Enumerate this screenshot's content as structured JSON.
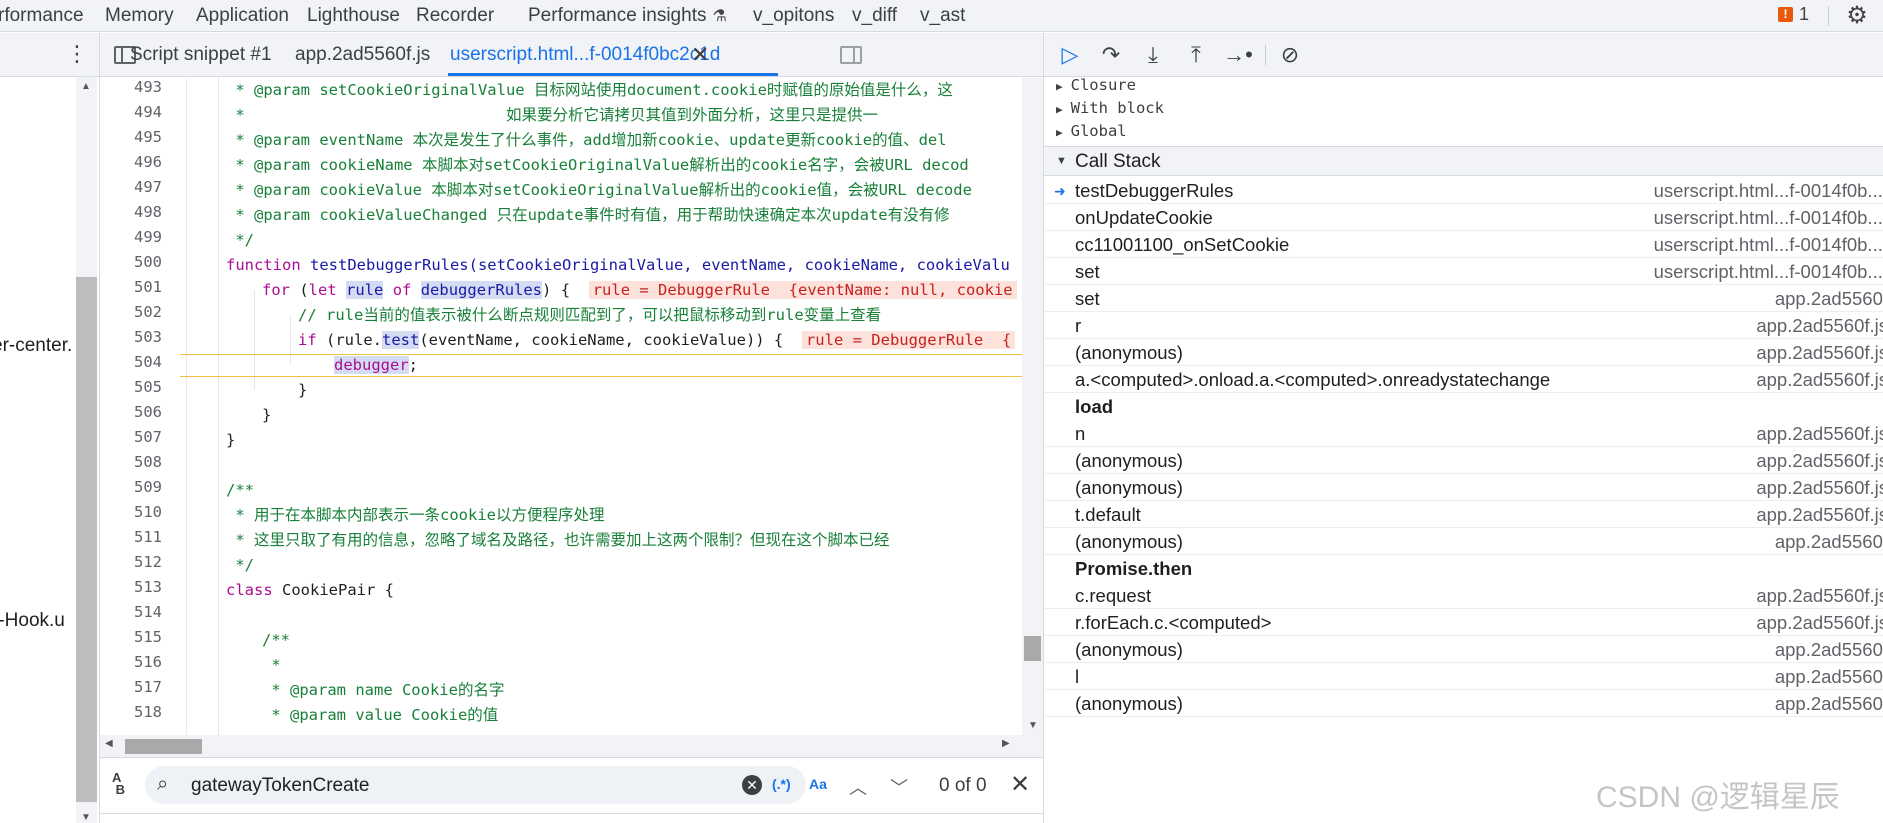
{
  "top_tabs": [
    "rformance",
    "Memory",
    "Application",
    "Lighthouse",
    "Recorder",
    "Performance insights",
    "v_opitons",
    "v_diff",
    "v_ast"
  ],
  "issues_count": "1",
  "navigator": {
    "items": [
      "er-center.",
      "r-Hook.u"
    ]
  },
  "editor_tabs": {
    "tabs": [
      "Script snippet #1",
      "app.2ad5560f.js",
      "userscript.html...f-0014f0bc2c1d"
    ],
    "active_index": 2
  },
  "code": {
    "line_numbers": [
      "493",
      "494",
      "495",
      "496",
      "497",
      "498",
      "499",
      "500",
      "501",
      "502",
      "503",
      "504",
      "505",
      "506",
      "507",
      "508",
      "509",
      "510",
      "511",
      "512",
      "513",
      "514",
      "515",
      "516",
      "517",
      "518"
    ],
    "l493": " * @param setCookieOriginalValue 目标网站使用document.cookie时赋值的原始值是什么，这",
    "l494": " *                            如果要分析它请拷贝其值到外面分析，这里只是提供一",
    "l495": " * @param eventName 本次是发生了什么事件，add增加新cookie、update更新cookie的值、del",
    "l496": " * @param cookieName 本脚本对setCookieOriginalValue解析出的cookie名字，会被URL decod",
    "l497": " * @param cookieValue 本脚本对setCookieOriginalValue解析出的cookie值，会被URL decode",
    "l498": " * @param cookieValueChanged 只在update事件时有值，用于帮助快速确定本次update有没有修",
    "l499": " */",
    "l500_kw": "function ",
    "l500_fn": "testDebuggerRules",
    "l500_args": "(setCookieOriginalValue, eventName, cookieName, cookieValu",
    "l501_for": "for",
    "l501_a": " (",
    "l501_let": "let",
    "l501_rule": "rule",
    "l501_of": "of",
    "l501_dr": "debuggerRules",
    "l501_b": ") {",
    "l501_inline": "rule = DebuggerRule  {eventName: null, cookie",
    "l502": "// rule当前的值表示被什么断点规则匹配到了，可以把鼠标移动到rule变量上查看",
    "l503_if": "if",
    "l503_a": " (rule.",
    "l503_test": "test",
    "l503_b": "(eventName, cookieName, cookieValue)) {",
    "l503_inline": "rule = DebuggerRule  {",
    "l504": "debugger",
    "l504_semi": ";",
    "l505": "}",
    "l506": "}",
    "l507": "}",
    "l509": "/**",
    "l510": " * 用于在本脚本内部表示一条cookie以方便程序处理",
    "l511": " * 这里只取了有用的信息，忽略了域名及路径，也许需要加上这两个限制？但现在这个脚本已经",
    "l512": " */",
    "l513_kw": "class ",
    "l513_name": "CookiePair {",
    "l515": "/**",
    "l516": " *",
    "l517": " * @param name Cookie的名字",
    "l518": " * @param value Cookie的值"
  },
  "search": {
    "value": "gatewayTokenCreate",
    "regex_label": "(.*)",
    "case_label": "Aa",
    "count": "0 of 0"
  },
  "scope": {
    "items": [
      "Closure",
      "With block",
      "Global"
    ]
  },
  "call_stack": {
    "title": "Call Stack",
    "frames": [
      {
        "name": "testDebuggerRules",
        "loc": "userscript.html...f-0014f0b...:"
      },
      {
        "name": "onUpdateCookie",
        "loc": "userscript.html...f-0014f0b...:"
      },
      {
        "name": "cc11001100_onSetCookie",
        "loc": "userscript.html...f-0014f0b...:"
      },
      {
        "name": "set",
        "loc": "userscript.html...f-0014f0b...:"
      },
      {
        "name": "set",
        "loc": "app.2ad5560f"
      },
      {
        "name": "r",
        "loc": "app.2ad5560f.js"
      },
      {
        "name": "(anonymous)",
        "loc": "app.2ad5560f.js"
      },
      {
        "name": "a.<computed>.onload.a.<computed>.onreadystatechange",
        "loc": "app.2ad5560f.js"
      },
      {
        "name": "load",
        "loc": ""
      },
      {
        "name": "n",
        "loc": "app.2ad5560f.js"
      },
      {
        "name": "(anonymous)",
        "loc": "app.2ad5560f.js"
      },
      {
        "name": "(anonymous)",
        "loc": "app.2ad5560f.js"
      },
      {
        "name": "t.default",
        "loc": "app.2ad5560f.js"
      },
      {
        "name": "(anonymous)",
        "loc": "app.2ad5560f"
      },
      {
        "name": "Promise.then",
        "loc": ""
      },
      {
        "name": "c.request",
        "loc": "app.2ad5560f.js"
      },
      {
        "name": "r.forEach.c.<computed>",
        "loc": "app.2ad5560f.js"
      },
      {
        "name": "(anonymous)",
        "loc": "app.2ad5560f"
      },
      {
        "name": "l",
        "loc": "app.2ad5560f"
      },
      {
        "name": "(anonymous)",
        "loc": "app.2ad5560f"
      }
    ]
  },
  "watermark": "CSDN @逻辑星辰"
}
